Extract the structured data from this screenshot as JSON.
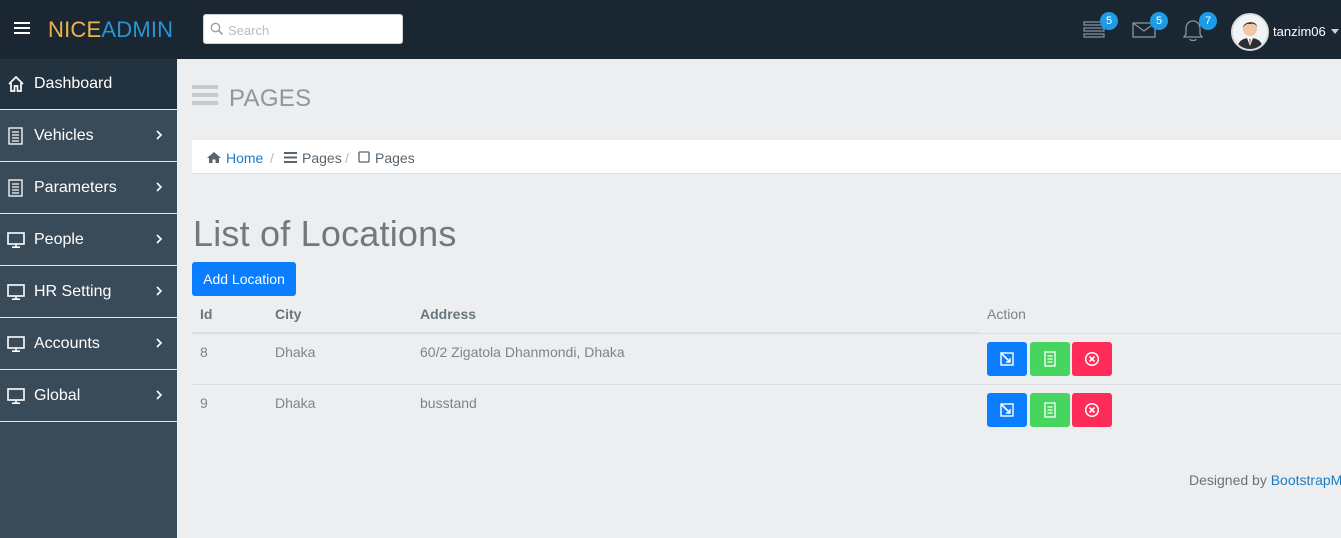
{
  "brand": {
    "part1": "NICE",
    "part2": "ADMIN"
  },
  "search": {
    "placeholder": "Search",
    "value": ""
  },
  "topbar": {
    "tasks_badge": "5",
    "mail_badge": "5",
    "notifications_badge": "7",
    "username": "tanzim06"
  },
  "sidebar": {
    "items": [
      {
        "label": "Dashboard",
        "icon": "home-icon"
      },
      {
        "label": "Vehicles",
        "icon": "document-icon"
      },
      {
        "label": "Parameters",
        "icon": "document-icon"
      },
      {
        "label": "People",
        "icon": "monitor-icon"
      },
      {
        "label": "HR Setting",
        "icon": "monitor-icon"
      },
      {
        "label": "Accounts",
        "icon": "monitor-icon"
      },
      {
        "label": "Global",
        "icon": "monitor-icon"
      }
    ]
  },
  "page": {
    "heading": "PAGES"
  },
  "breadcrumb": {
    "home": "Home",
    "pages1": "Pages",
    "pages2": "Pages"
  },
  "main": {
    "title": "List of Locations",
    "add_button": "Add Location"
  },
  "table": {
    "headers": {
      "id": "Id",
      "city": "City",
      "address": "Address",
      "action": "Action"
    },
    "rows": [
      {
        "id": "8",
        "city": "Dhaka",
        "address": "60/2 Zigatola Dhanmondi, Dhaka"
      },
      {
        "id": "9",
        "city": "Dhaka",
        "address": "busstand"
      }
    ]
  },
  "footer": {
    "text": "Designed by",
    "link": "BootstrapM"
  },
  "colors": {
    "topbar": "#1a2732",
    "sidebar": "#394a59",
    "primary": "#0b7dff",
    "success": "#47d45f",
    "danger": "#ff2c59",
    "badge": "#1c9be6"
  }
}
